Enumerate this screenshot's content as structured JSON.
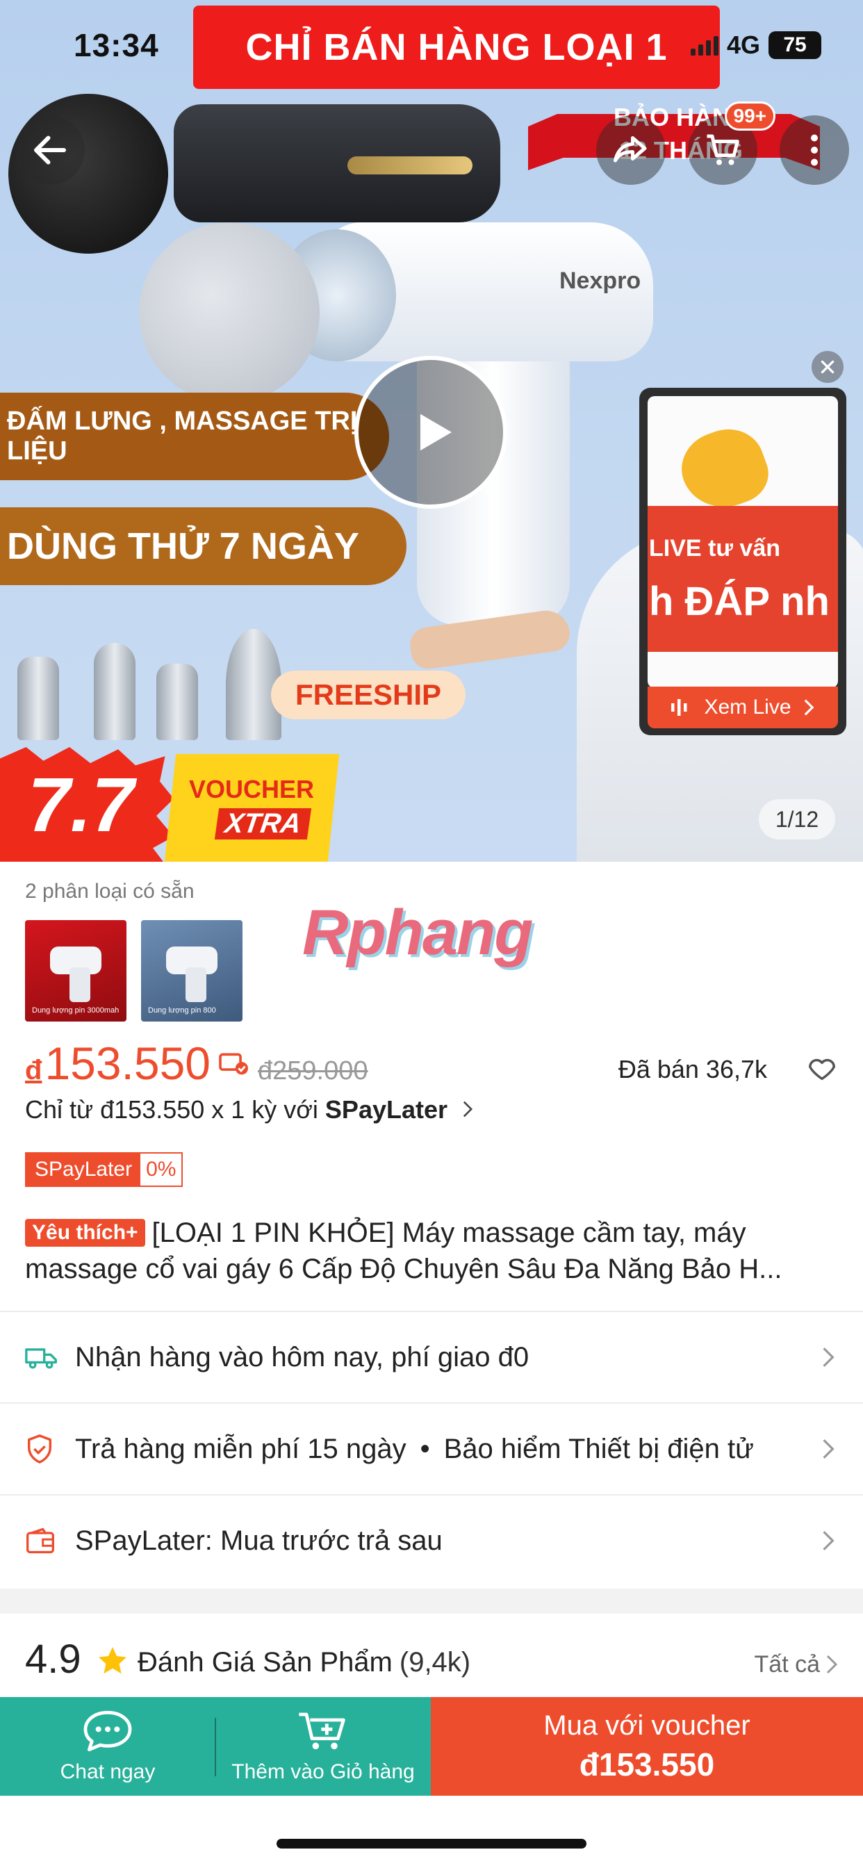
{
  "status_bar": {
    "time": "13:34",
    "network": "4G",
    "battery": "75"
  },
  "hero": {
    "top_banner": "CHỈ BÁN HÀNG LOẠI 1",
    "brand_on_product": "Nexpro",
    "warranty_ribbon": "BẢO HÀNH\n12 THÁNG",
    "cart_badge": "99+",
    "promo_pill_1": "ĐẤM LƯNG , MASSAGE TRỊ LIỆU",
    "promo_pill_2": "DÙNG THỬ 7 NGÀY",
    "freeship": "FREESHIP",
    "voucher_number": "7.7",
    "voucher_label": "VOUCHER",
    "voucher_xtra": "XTRA",
    "image_counter": "1/12",
    "live": {
      "line1": "LIVE tư vấn",
      "line2": "h ĐÁP nh",
      "button": "Xem Live"
    },
    "icons": [
      "back-arrow-icon",
      "share-icon",
      "cart-icon",
      "more-icon",
      "play-icon",
      "close-icon"
    ]
  },
  "variants": {
    "label": "2 phân loại có sẵn",
    "thumb1_caption": "Dung lượng pin 3000mah",
    "thumb2_caption": "Dung lượng pin 800"
  },
  "watermark": "Rphang",
  "price": {
    "currency": "đ",
    "current": "153.550",
    "original": "đ259.000",
    "sold": "Đã bán 36,7k",
    "installment_prefix": "Chỉ từ đ153.550 x 1 kỳ với ",
    "installment_brand": "SPayLater",
    "spaylater_badge_left": "SPayLater",
    "spaylater_badge_right": "0%"
  },
  "product": {
    "fav_badge": "Yêu thích+",
    "title_line1": "[LOẠI 1 PIN KHỎE] Máy massage cầm tay, máy",
    "title_line2": "massage cổ vai gáy 6 Cấp Độ Chuyên Sâu Đa Năng Bảo H..."
  },
  "info_rows": {
    "shipping": "Nhận hàng vào hôm nay, phí giao đ0",
    "returns": "Trả hàng miễn phí 15 ngày",
    "insurance": "Bảo hiểm Thiết bị điện tử",
    "spaylater": "SPayLater: Mua trước trả sau"
  },
  "rating": {
    "score": "4.9",
    "title": "Đánh Giá Sản Phẩm",
    "count": "(9,4k)",
    "see_all": "Tất cả"
  },
  "bottom_bar": {
    "chat": "Chat ngay",
    "add_cart": "Thêm vào Giỏ hàng",
    "buy_line1": "Mua với voucher",
    "buy_line2": "đ153.550"
  },
  "colors": {
    "shopee_orange": "#ee4d2d",
    "bottom_green": "#27b19a",
    "hero_bg": "#bcd4ef"
  }
}
